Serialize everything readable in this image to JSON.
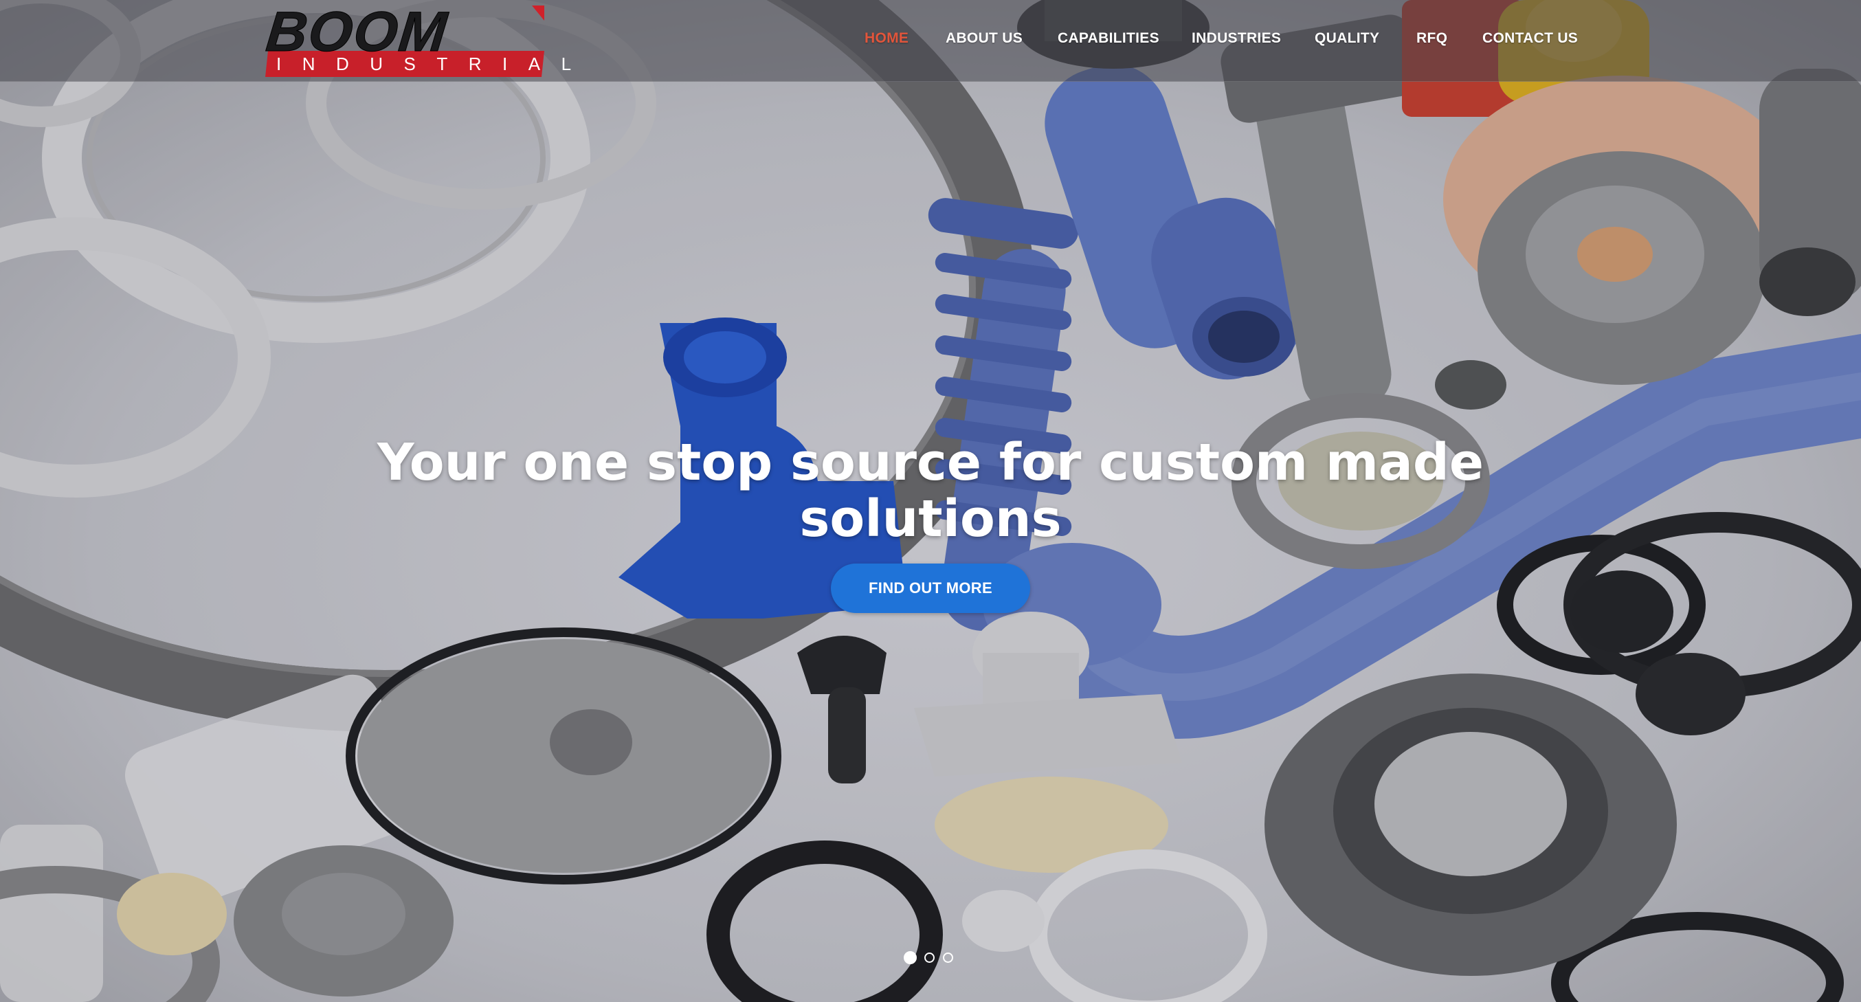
{
  "brand": {
    "name": "BOOM",
    "subtitle": "INDUSTRIAL",
    "logo_colors": {
      "wordmark": "#1a1a1c",
      "band": "#c8202a"
    }
  },
  "nav": {
    "items": [
      {
        "label": "HOME",
        "active": true
      },
      {
        "label": "ABOUT US",
        "active": false
      },
      {
        "label": "CAPABILITIES",
        "active": false
      },
      {
        "label": "INDUSTRIES",
        "active": false
      },
      {
        "label": "QUALITY",
        "active": false
      },
      {
        "label": "RFQ",
        "active": false
      },
      {
        "label": "CONTACT US",
        "active": false
      }
    ],
    "active_color": "#e2553b"
  },
  "hero": {
    "headline_line1": "Your one stop source for custom made",
    "headline_line2": "solutions",
    "cta_label": "FIND OUT MORE",
    "cta_color": "#1f73d8",
    "background": "photo of assorted molded rubber and plastic parts: gaskets, o-rings, seals, blue tubes and fittings",
    "slides": {
      "count": 3,
      "current": 1
    }
  }
}
